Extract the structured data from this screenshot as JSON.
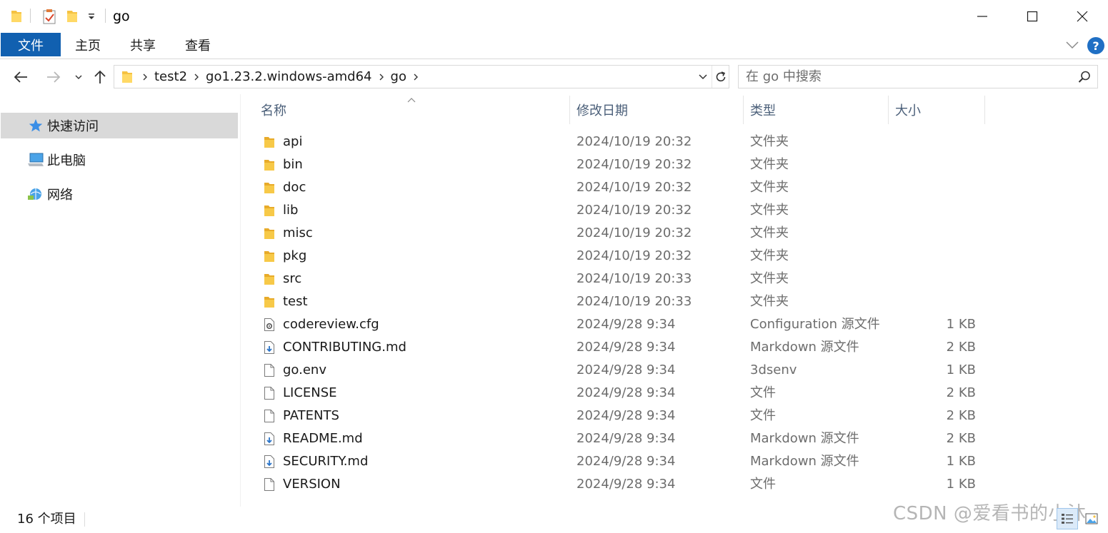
{
  "window": {
    "title": "go",
    "minimize": "minimize",
    "maximize": "maximize",
    "close": "close"
  },
  "ribbon": {
    "tabs": [
      "文件",
      "主页",
      "共享",
      "查看"
    ],
    "help": "?"
  },
  "address": {
    "crumbs": [
      "test2",
      "go1.23.2.windows-amd64",
      "go"
    ]
  },
  "search": {
    "placeholder": "在 go 中搜索"
  },
  "nav_pane": {
    "items": [
      "快速访问",
      "此电脑",
      "网络"
    ]
  },
  "columns": [
    "名称",
    "修改日期",
    "类型",
    "大小"
  ],
  "files": [
    {
      "name": "api",
      "date": "2024/10/19 20:32",
      "type": "文件夹",
      "size": "",
      "icon": "folder-icon"
    },
    {
      "name": "bin",
      "date": "2024/10/19 20:32",
      "type": "文件夹",
      "size": "",
      "icon": "folder-icon"
    },
    {
      "name": "doc",
      "date": "2024/10/19 20:32",
      "type": "文件夹",
      "size": "",
      "icon": "folder-icon"
    },
    {
      "name": "lib",
      "date": "2024/10/19 20:32",
      "type": "文件夹",
      "size": "",
      "icon": "folder-icon"
    },
    {
      "name": "misc",
      "date": "2024/10/19 20:32",
      "type": "文件夹",
      "size": "",
      "icon": "folder-icon"
    },
    {
      "name": "pkg",
      "date": "2024/10/19 20:32",
      "type": "文件夹",
      "size": "",
      "icon": "folder-icon"
    },
    {
      "name": "src",
      "date": "2024/10/19 20:33",
      "type": "文件夹",
      "size": "",
      "icon": "folder-icon"
    },
    {
      "name": "test",
      "date": "2024/10/19 20:33",
      "type": "文件夹",
      "size": "",
      "icon": "folder-icon"
    },
    {
      "name": "codereview.cfg",
      "date": "2024/9/28 9:34",
      "type": "Configuration 源文件",
      "size": "1 KB",
      "icon": "config-file-icon"
    },
    {
      "name": "CONTRIBUTING.md",
      "date": "2024/9/28 9:34",
      "type": "Markdown 源文件",
      "size": "2 KB",
      "icon": "markdown-file-icon"
    },
    {
      "name": "go.env",
      "date": "2024/9/28 9:34",
      "type": "3dsenv",
      "size": "1 KB",
      "icon": "file-icon"
    },
    {
      "name": "LICENSE",
      "date": "2024/9/28 9:34",
      "type": "文件",
      "size": "2 KB",
      "icon": "file-icon"
    },
    {
      "name": "PATENTS",
      "date": "2024/9/28 9:34",
      "type": "文件",
      "size": "2 KB",
      "icon": "file-icon"
    },
    {
      "name": "README.md",
      "date": "2024/9/28 9:34",
      "type": "Markdown 源文件",
      "size": "2 KB",
      "icon": "markdown-file-icon"
    },
    {
      "name": "SECURITY.md",
      "date": "2024/9/28 9:34",
      "type": "Markdown 源文件",
      "size": "1 KB",
      "icon": "markdown-file-icon"
    },
    {
      "name": "VERSION",
      "date": "2024/9/28 9:34",
      "type": "文件",
      "size": "1 KB",
      "icon": "file-icon"
    }
  ],
  "status": {
    "item_count": "16 个项目"
  },
  "watermark": "CSDN @爱看书的小沐",
  "colors": {
    "accent": "#1160b0",
    "folder": "#f5c242",
    "selected_nav": "#d9d9d9",
    "header_text": "#4c607a"
  }
}
